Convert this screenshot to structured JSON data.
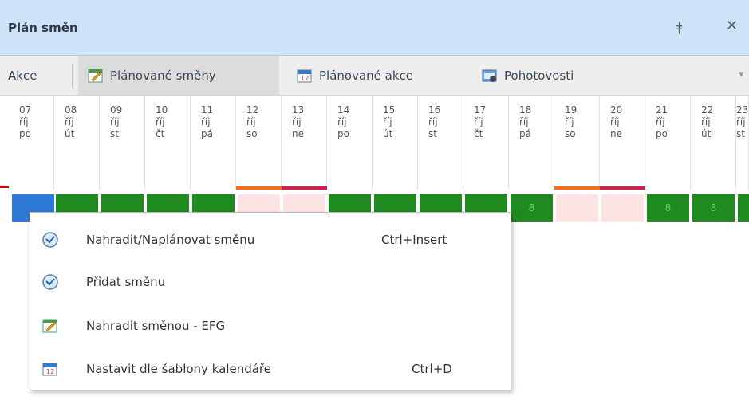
{
  "window": {
    "title": "Plán směn",
    "pin_icon": "pin-icon",
    "close_icon": "close-icon"
  },
  "toolbar": {
    "actions_label": "Akce",
    "planned_shifts_label": "Plánované směny",
    "planned_actions_label": "Plánované akce",
    "on_call_label": "Pohotovosti",
    "more_label": "▾"
  },
  "days": [
    {
      "day": "07",
      "month": "říj",
      "weekday": "po"
    },
    {
      "day": "08",
      "month": "říj",
      "weekday": "út"
    },
    {
      "day": "09",
      "month": "říj",
      "weekday": "st"
    },
    {
      "day": "10",
      "month": "říj",
      "weekday": "čt"
    },
    {
      "day": "11",
      "month": "říj",
      "weekday": "pá"
    },
    {
      "day": "12",
      "month": "říj",
      "weekday": "so"
    },
    {
      "day": "13",
      "month": "říj",
      "weekday": "ne"
    },
    {
      "day": "14",
      "month": "říj",
      "weekday": "po"
    },
    {
      "day": "15",
      "month": "říj",
      "weekday": "út"
    },
    {
      "day": "16",
      "month": "říj",
      "weekday": "st"
    },
    {
      "day": "17",
      "month": "říj",
      "weekday": "čt"
    },
    {
      "day": "18",
      "month": "říj",
      "weekday": "pá"
    },
    {
      "day": "19",
      "month": "říj",
      "weekday": "so"
    },
    {
      "day": "20",
      "month": "říj",
      "weekday": "ne"
    },
    {
      "day": "21",
      "month": "říj",
      "weekday": "po"
    },
    {
      "day": "22",
      "month": "říj",
      "weekday": "út"
    },
    {
      "day": "23",
      "month": "říj",
      "weekday": "st"
    }
  ],
  "shift_cells": {
    "c12": "8",
    "c15": "8",
    "c16": "8"
  },
  "colors": {
    "weekend_saturday": "#f07020",
    "weekend_sunday": "#d02050",
    "work_shift": "#1f8a1f",
    "weekend_cell": "#fde4e4",
    "selected": "#2e78d6"
  },
  "context_menu": {
    "items": [
      {
        "label": "Nahradit/Naplánovat směnu",
        "shortcut": "Ctrl+Insert",
        "icon": "clock-arrow-icon"
      },
      {
        "label": "Přidat směnu",
        "shortcut": "",
        "icon": "clock-arrow-icon"
      },
      {
        "label": "Nahradit směnou - EFG",
        "shortcut": "",
        "icon": "edit-calendar-icon"
      },
      {
        "label": "Nastavit dle šablony kalendáře",
        "shortcut": "Ctrl+D",
        "icon": "calendar-icon"
      }
    ]
  }
}
